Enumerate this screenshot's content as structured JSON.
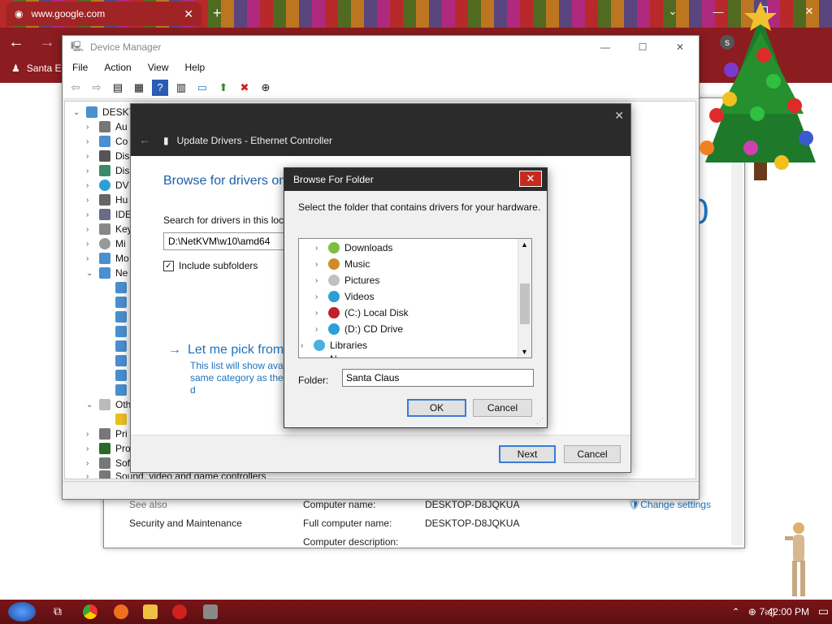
{
  "browser": {
    "tab_title": "www.google.com",
    "tab_close": "✕",
    "new_tab": "+",
    "bookmark": "Santa E",
    "profile": "s"
  },
  "sysinfo": {
    "see_also": "See also",
    "security": "Security and Maintenance",
    "comp_name_label": "Computer name:",
    "comp_name": "DESKTOP-D8JQKUA",
    "full_name_label": "Full computer name:",
    "full_name": "DESKTOP-D8JQKUA",
    "desc_label": "Computer description:",
    "change_settings": "Change settings",
    "big_digit": "0"
  },
  "devmgr": {
    "title": "Device Manager",
    "menu": [
      "File",
      "Action",
      "View",
      "Help"
    ],
    "root": "DESKTO",
    "items": [
      "Au",
      "Co",
      "Dis",
      "Dis",
      "DV",
      "Hu",
      "IDE",
      "Key",
      "Mi",
      "Mo",
      "Ne",
      "Oth",
      "Pri",
      "Pro",
      "Sof"
    ],
    "bottom_item": "Sound, video and game controllers"
  },
  "update": {
    "title": "Update Drivers - Ethernet Controller",
    "heading": "Browse for drivers on",
    "search_label": "Search for drivers in this loca",
    "path": "D:\\NetKVM\\w10\\amd64",
    "include_sub": "Include subfolders",
    "pick": "Let me pick from",
    "pick_desc1": "This list will show avai",
    "pick_desc2": "same category as the d",
    "next": "Next",
    "cancel": "Cancel",
    "close": "✕"
  },
  "browse": {
    "title": "Browse For Folder",
    "message": "Select the folder that contains drivers for your hardware.",
    "tree": [
      {
        "label": "Downloads",
        "color": "#7cbf3c"
      },
      {
        "label": "Music",
        "color": "#d08a2a"
      },
      {
        "label": "Pictures",
        "color": "#c0c0c0"
      },
      {
        "label": "Videos",
        "color": "#2aa0d6"
      },
      {
        "label": "(C:) Local Disk",
        "color": "#c0202a"
      },
      {
        "label": "(D:) CD Drive",
        "color": "#2aa0d6"
      }
    ],
    "libraries": "Libraries",
    "partial": "N",
    "folder_label": "Folder:",
    "folder_value": "Santa Claus",
    "ok": "OK",
    "cancel": "Cancel",
    "close": "✕"
  },
  "taskbar": {
    "time": "7:42:00 PM"
  }
}
